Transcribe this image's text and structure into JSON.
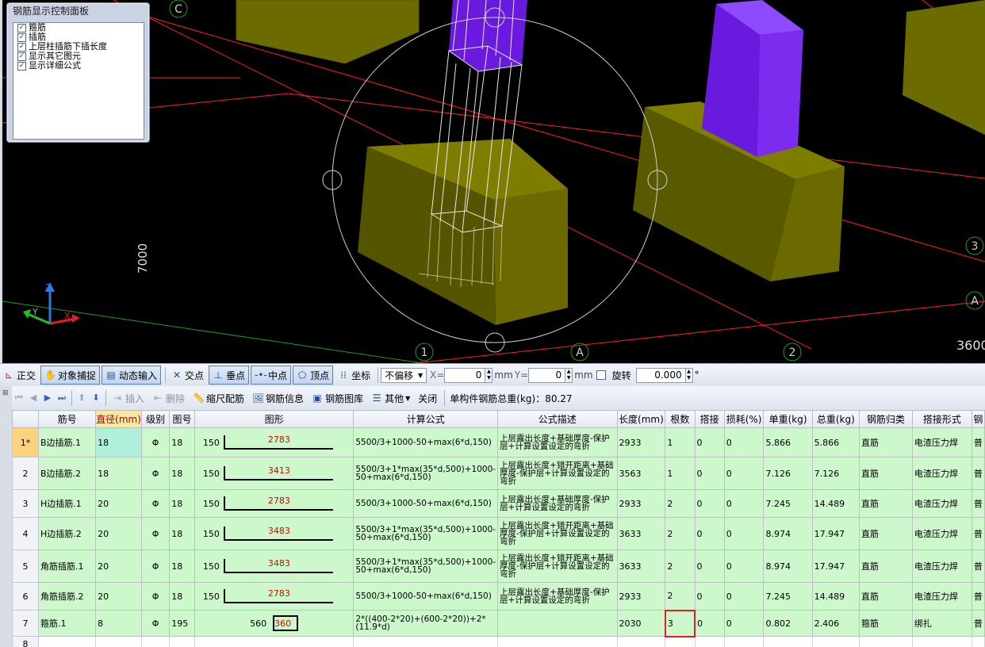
{
  "viewport": {
    "grid_labels": [
      "C",
      "1",
      "A",
      "2",
      "3",
      "A"
    ],
    "dimension_left": "7000",
    "dimension_right": "3600",
    "axis_labels": {
      "z": "Z",
      "y": "Y",
      "x": "X"
    },
    "colors": {
      "background": "#000000",
      "footing": "#6b6b00",
      "column": "#6a1adf",
      "grid_line": "#ff2020",
      "axis_line": "#1e9b1e"
    }
  },
  "panel": {
    "title": "钢筋显示控制面板",
    "options": [
      {
        "label": "箍筋",
        "checked": true
      },
      {
        "label": "插筋",
        "checked": true
      },
      {
        "label": "上层柱插筋下插长度",
        "checked": true
      },
      {
        "label": "显示其它图元",
        "checked": true
      },
      {
        "label": "显示详细公式",
        "checked": true
      }
    ]
  },
  "toolbar1": {
    "ortho": "正交",
    "snap": "对象捕捉",
    "dyn_input": "动态输入",
    "intersect": "交点",
    "perp": "垂点",
    "mid": "中点",
    "vertex": "顶点",
    "coord": "坐标",
    "offset_mode": "不偏移",
    "x_label": "X=",
    "x_value": "0",
    "mm1": "mm",
    "y_label": "Y=",
    "y_value": "0",
    "mm2": "mm",
    "rotate_label": "旋转",
    "rotate_value": "0.000",
    "degree": "°"
  },
  "toolbar2": {
    "insert": "插入",
    "delete": "删除",
    "scale": "缩尺配筋",
    "info": "钢筋信息",
    "library": "钢筋图库",
    "other": "其他",
    "close": "关闭",
    "total_label": "单构件钢筋总重(kg)：80.27"
  },
  "table": {
    "headers": [
      "筋号",
      "直径(mm)",
      "级别",
      "图号",
      "图形",
      "计算公式",
      "公式描述",
      "长度(mm)",
      "根数",
      "搭接",
      "损耗(%)",
      "单重(kg)",
      "总重(kg)",
      "钢筋归类",
      "搭接形式",
      "钢"
    ],
    "rows": [
      {
        "no": "1*",
        "name": "B边插筋.1",
        "dia": "18",
        "grade": "Φ",
        "fig": "18",
        "lead": "150",
        "shape_val": "2783",
        "formula": "5500/3+1000-50+max(6*d,150)",
        "desc": "上层露出长度+基础厚度-保护层+计算设置设定的弯折",
        "len": "2933",
        "count": "1",
        "lap": "0",
        "loss": "0",
        "unit_w": "5.866",
        "total_w": "5.866",
        "cat": "直筋",
        "lap_type": "电渣压力焊",
        "last": "普"
      },
      {
        "no": "2",
        "name": "B边插筋.2",
        "dia": "18",
        "grade": "Φ",
        "fig": "18",
        "lead": "150",
        "shape_val": "3413",
        "formula": "5500/3+1*max(35*d,500)+1000-50+max(6*d,150)",
        "desc": "上层露出长度+错开距离+基础厚度-保护层+计算设置设定的弯折",
        "len": "3563",
        "count": "1",
        "lap": "0",
        "loss": "0",
        "unit_w": "7.126",
        "total_w": "7.126",
        "cat": "直筋",
        "lap_type": "电渣压力焊",
        "last": "普"
      },
      {
        "no": "3",
        "name": "H边插筋.1",
        "dia": "20",
        "grade": "Φ",
        "fig": "18",
        "lead": "150",
        "shape_val": "2783",
        "formula": "5500/3+1000-50+max(6*d,150)",
        "desc": "上层露出长度+基础厚度-保护层+计算设置设定的弯折",
        "len": "2933",
        "count": "2",
        "lap": "0",
        "loss": "0",
        "unit_w": "7.245",
        "total_w": "14.489",
        "cat": "直筋",
        "lap_type": "电渣压力焊",
        "last": "普"
      },
      {
        "no": "4",
        "name": "H边插筋.2",
        "dia": "20",
        "grade": "Φ",
        "fig": "18",
        "lead": "150",
        "shape_val": "3483",
        "formula": "5500/3+1*max(35*d,500)+1000-50+max(6*d,150)",
        "desc": "上层露出长度+错开距离+基础厚度-保护层+计算设置设定的弯折",
        "len": "3633",
        "count": "2",
        "lap": "0",
        "loss": "0",
        "unit_w": "8.974",
        "total_w": "17.947",
        "cat": "直筋",
        "lap_type": "电渣压力焊",
        "last": "普"
      },
      {
        "no": "5",
        "name": "角筋插筋.1",
        "dia": "20",
        "grade": "Φ",
        "fig": "18",
        "lead": "150",
        "shape_val": "3483",
        "formula": "5500/3+1*max(35*d,500)+1000-50+max(6*d,150)",
        "desc": "上层露出长度+错开距离+基础厚度-保护层+计算设置设定的弯折",
        "len": "3633",
        "count": "2",
        "lap": "0",
        "loss": "0",
        "unit_w": "8.974",
        "total_w": "17.947",
        "cat": "直筋",
        "lap_type": "电渣压力焊",
        "last": "普"
      },
      {
        "no": "6",
        "name": "角筋插筋.2",
        "dia": "20",
        "grade": "Φ",
        "fig": "18",
        "lead": "150",
        "shape_val": "2783",
        "formula": "5500/3+1000-50+max(6*d,150)",
        "desc": "上层露出长度+基础厚度-保护层+计算设置设定的弯折",
        "len": "2933",
        "count": "2",
        "lap": "0",
        "loss": "0",
        "unit_w": "7.245",
        "total_w": "14.489",
        "cat": "直筋",
        "lap_type": "电渣压力焊",
        "last": "普"
      }
    ],
    "stirrup": {
      "no": "7",
      "name": "箍筋.1",
      "dia": "8",
      "grade": "Φ",
      "fig": "195",
      "lead": "560",
      "shape_val": "360",
      "formula": "2*((400-2*20)+(600-2*20))+2*(11.9*d)",
      "desc": "",
      "len": "2030",
      "count": "3",
      "lap": "0",
      "loss": "0",
      "unit_w": "0.802",
      "total_w": "2.406",
      "cat": "箍筋",
      "lap_type": "绑扎",
      "last": "普"
    },
    "empty_row_no": "8"
  }
}
